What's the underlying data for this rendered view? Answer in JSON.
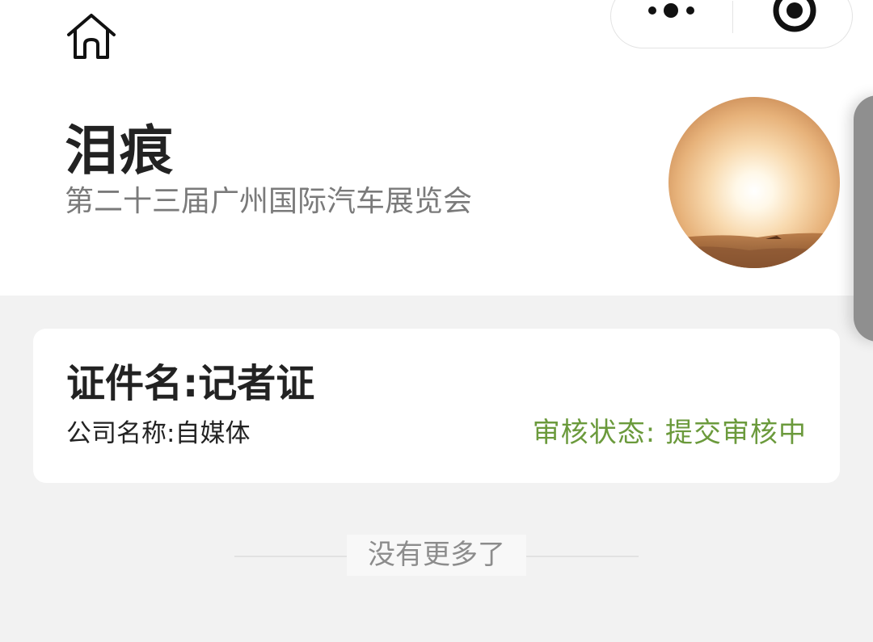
{
  "nav": {
    "home_icon": "home-icon",
    "more_icon": "more-dots-icon",
    "close_icon": "target-circle-icon"
  },
  "profile": {
    "name": "泪痕",
    "event": "第二十三届广州国际汽车展览会",
    "avatar_icon": "sunset-avatar"
  },
  "certificate": {
    "title": "证件名:记者证",
    "company": "公司名称:自媒体",
    "status": "审核状态:  提交审核中",
    "status_color": "#6b9a3c"
  },
  "footer": {
    "no_more": "没有更多了"
  }
}
